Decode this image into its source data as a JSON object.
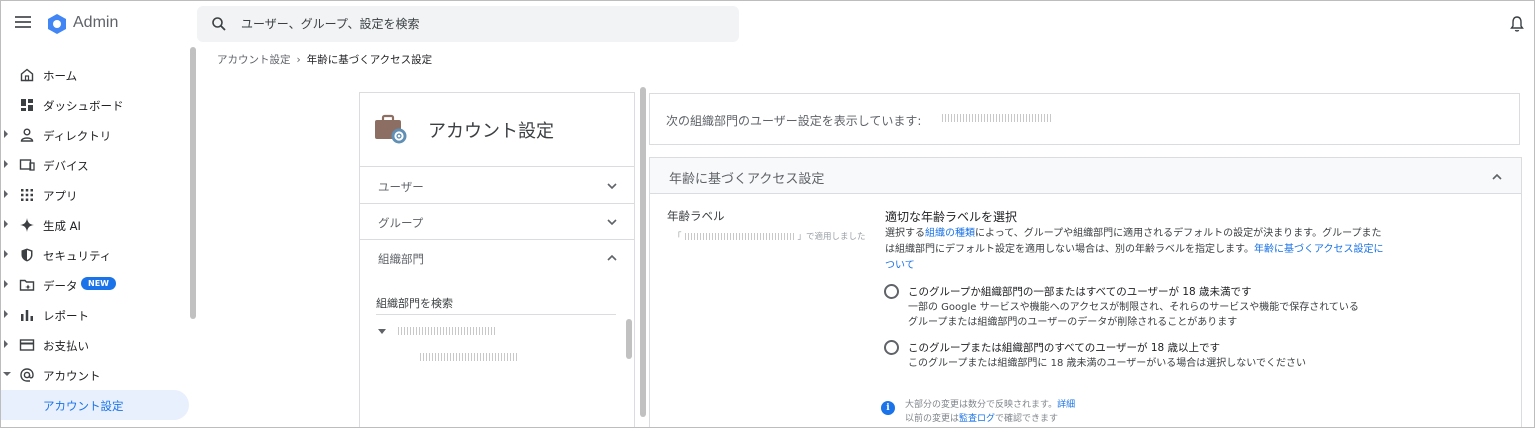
{
  "app": {
    "title": "Admin"
  },
  "search": {
    "placeholder": "ユーザー、グループ、設定を検索"
  },
  "sidebar": {
    "items": [
      {
        "label": "ホーム",
        "icon": "home-icon"
      },
      {
        "label": "ダッシュボード",
        "icon": "dashboard-icon"
      },
      {
        "label": "ディレクトリ",
        "icon": "person-icon"
      },
      {
        "label": "デバイス",
        "icon": "devices-icon"
      },
      {
        "label": "アプリ",
        "icon": "apps-grid-icon"
      },
      {
        "label": "生成 AI",
        "icon": "sparkle-icon"
      },
      {
        "label": "セキュリティ",
        "icon": "shield-icon"
      },
      {
        "label": "データ",
        "icon": "data-folder-icon",
        "badge": "NEW"
      },
      {
        "label": "レポート",
        "icon": "bar-chart-icon"
      },
      {
        "label": "お支払い",
        "icon": "credit-card-icon"
      },
      {
        "label": "アカウント",
        "icon": "at-sign-icon"
      },
      {
        "label": "アカウント設定",
        "selected": true
      }
    ]
  },
  "breadcrumb": {
    "parent": "アカウント設定",
    "separator": "›",
    "current": "年齢に基づくアクセス設定"
  },
  "left_panel": {
    "title": "アカウント設定",
    "rows": [
      {
        "label": "ユーザー"
      },
      {
        "label": "グループ"
      },
      {
        "label": "組織部門"
      }
    ],
    "org_search_placeholder": "組織部門を検索"
  },
  "info_bar": {
    "text": "次の組織部門のユーザー設定を表示しています:"
  },
  "section": {
    "title": "年齢に基づくアクセス設定",
    "field_label": "年齢ラベル",
    "applied_suffix": "で適用しました",
    "choose_title": "適切な年齢ラベルを選択",
    "desc_part1": "選択する",
    "desc_link1": "組織の種類",
    "desc_part2": "によって、グループや組織部門に適用されるデフォルトの設定が決まります。グループまたは組織部門にデフォルト設定を適用しない場合は、別の年齢ラベルを指定します。",
    "desc_link2": "年齢に基づくアクセス設定について",
    "options": [
      {
        "title": "このグループか組織部門の一部またはすべてのユーザーが 18 歳未満です",
        "desc_line1": "一部の Google サービスや機能へのアクセスが制限され、それらのサービスや機能で保存されている",
        "desc_line2": "グループまたは組織部門のユーザーのデータが削除されることがあります"
      },
      {
        "title": "このグループまたは組織部門のすべてのユーザーが 18 歳以上です",
        "desc_line1": "このグループまたは組織部門に 18 歳未満のユーザーがいる場合は選択しないでください"
      }
    ],
    "note_line1": "大部分の変更は数分で反映されます。",
    "note_link1": "詳細",
    "note_line2_part1": "以前の変更は",
    "note_link2": "監査ログ",
    "note_line2_part2": "で確認できます"
  },
  "colors": {
    "accent": "#1a73e8",
    "selected_bg": "#e8f0fe",
    "border": "#dadce0"
  }
}
